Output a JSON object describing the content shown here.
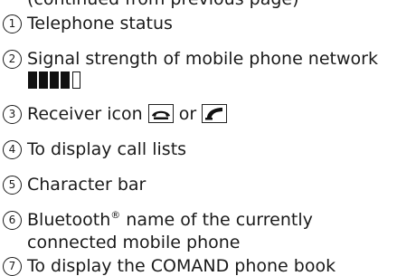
{
  "top_fragment": "(continued from previous page)",
  "items": [
    {
      "num": "1",
      "text": "Telephone status"
    },
    {
      "num": "2",
      "text": "Signal strength of mobile phone network",
      "signal": {
        "filled_bars": 4,
        "total_bars": 5
      }
    },
    {
      "num": "3",
      "text_before": "Receiver icon",
      "text_mid": "or",
      "icons": [
        "receiver-hung-up-icon",
        "receiver-lifted-icon"
      ]
    },
    {
      "num": "4",
      "text": "To display call lists"
    },
    {
      "num": "5",
      "text": "Character bar"
    },
    {
      "num": "6",
      "text_before": "Bluetooth",
      "sup": "®",
      "text_after": " name of the currently",
      "text_line2": "connected mobile phone"
    },
    {
      "num": "7",
      "text": "To display the COMAND phone book"
    }
  ]
}
